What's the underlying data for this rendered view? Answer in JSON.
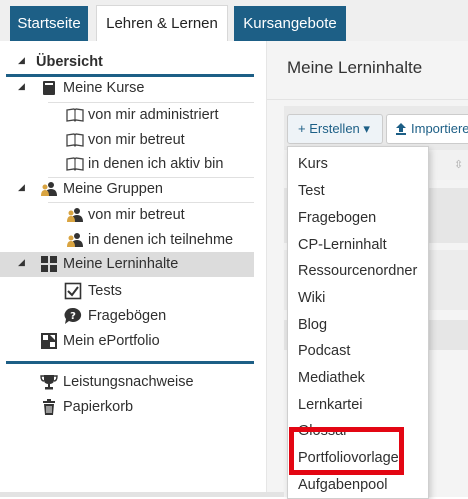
{
  "tabs": [
    {
      "label": "Startseite"
    },
    {
      "label": "Lehren & Lernen"
    },
    {
      "label": "Kursangebote"
    }
  ],
  "sidebar": {
    "overview": "Übersicht",
    "meine_kurse": "Meine Kurse",
    "kurse_items": [
      "von mir administriert",
      "von mir betreut",
      "in denen ich aktiv bin"
    ],
    "meine_gruppen": "Meine Gruppen",
    "gruppen_items": [
      "von mir betreut",
      "in denen ich teilnehme"
    ],
    "meine_lerninhalte": "Meine Lerninhalte",
    "lerninhalte_items": [
      "Tests",
      "Fragebögen"
    ],
    "mein_eportfolio": "Mein ePortfolio",
    "leistungsnachweise": "Leistungsnachweise",
    "papierkorb": "Papierkorb"
  },
  "main": {
    "title": "Meine Lerninhalte",
    "create_label": "+ Erstellen ▾",
    "import_label": "Importieren"
  },
  "dropdown": {
    "items": [
      "Kurs",
      "Test",
      "Fragebogen",
      "CP-Lerninhalt",
      "Ressourcenordner",
      "Wiki",
      "Blog",
      "Podcast",
      "Mediathek",
      "Lernkartei",
      "Glossar",
      "Portfoliovorlage",
      "Aufgabenpool"
    ],
    "highlighted": "Portfoliovorlage"
  },
  "colors": {
    "brand": "#1d5f86",
    "highlight": "#e30613"
  }
}
